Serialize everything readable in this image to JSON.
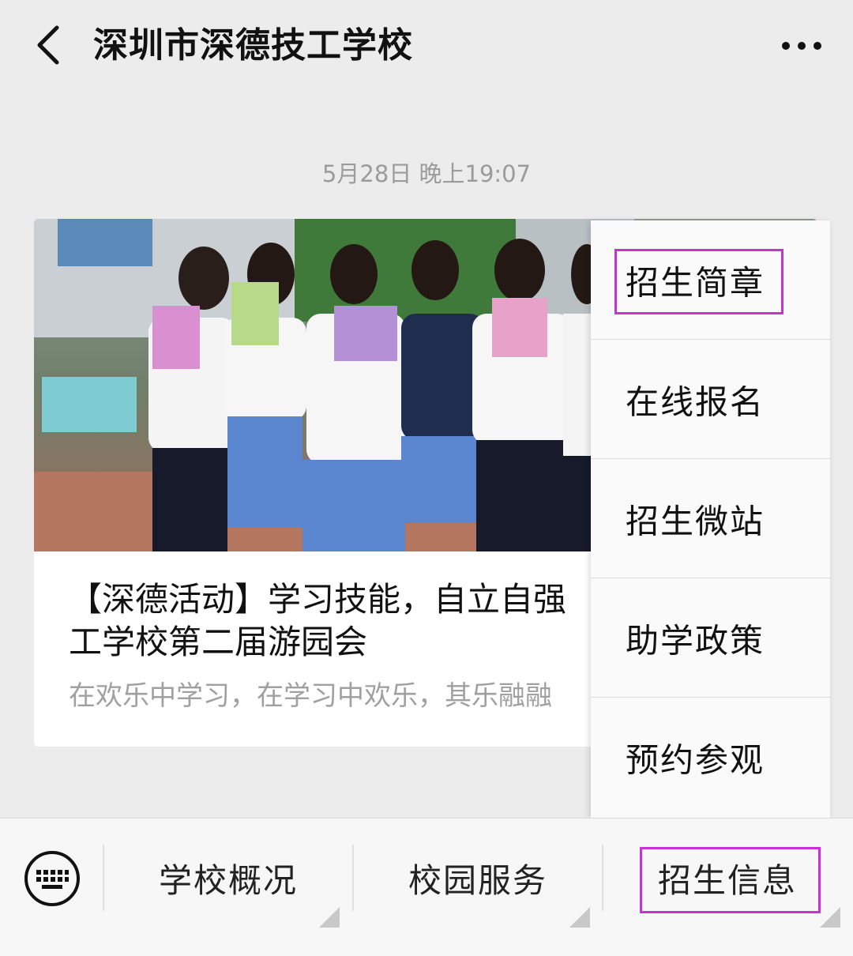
{
  "header": {
    "title": "深圳市深德技工学校"
  },
  "message": {
    "timestamp": "5月28日 晚上19:07"
  },
  "article": {
    "title": "【深德活动】学习技能，自立自强\n工学校第二届游园会",
    "description": "在欢乐中学习，在学习中欢乐，其乐融融"
  },
  "popup_menu": {
    "items": [
      {
        "label": "招生简章"
      },
      {
        "label": "在线报名"
      },
      {
        "label": "招生微站"
      },
      {
        "label": "助学政策"
      },
      {
        "label": "预约参观"
      }
    ]
  },
  "bottom_menu": {
    "items": [
      {
        "label": "学校概况"
      },
      {
        "label": "校园服务"
      },
      {
        "label": "招生信息"
      }
    ]
  },
  "colors": {
    "highlight": "#c832d4",
    "background": "#ececec"
  },
  "icons": {
    "back": "chevron-left-icon",
    "more": "more-dots-icon",
    "keyboard": "keyboard-icon"
  }
}
